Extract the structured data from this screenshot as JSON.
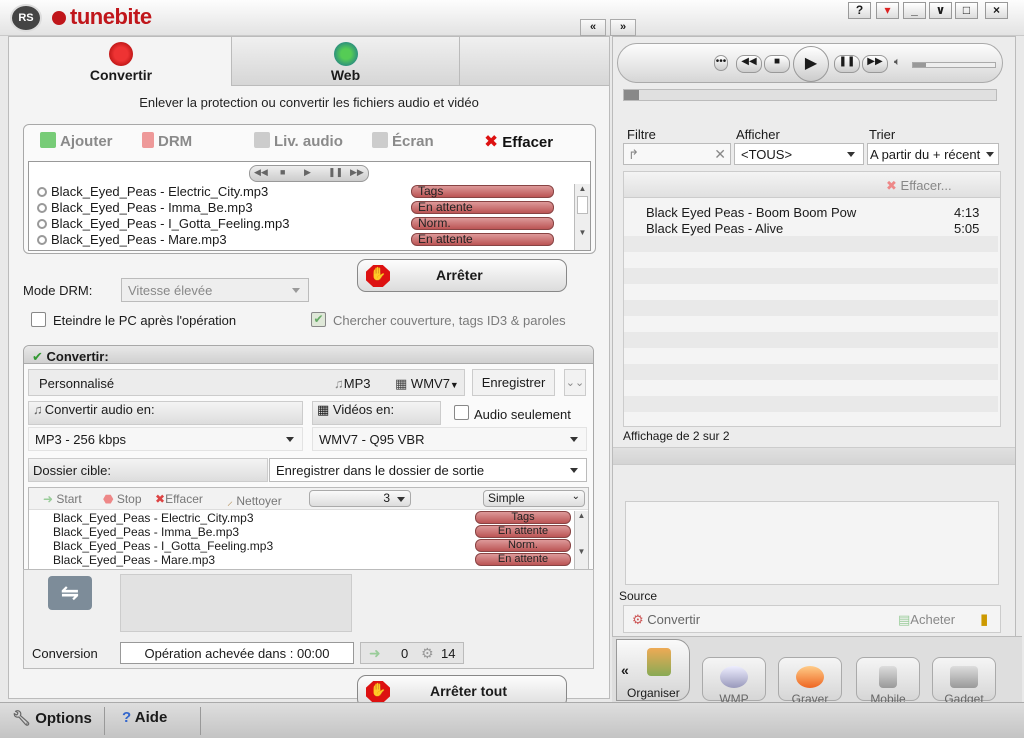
{
  "app": {
    "brand": "tunebite",
    "logo_text": "RS",
    "collapse_left": "«",
    "expand_right": "»",
    "window_buttons": [
      "?",
      "",
      "_",
      "∨",
      "□",
      "×"
    ]
  },
  "tabs": {
    "convert": "Convertir",
    "web": "Web"
  },
  "subtitle": "Enlever la protection ou convertir les fichiers audio et vidéo",
  "top_toolbar": {
    "add": "Ajouter",
    "drm": "DRM",
    "audio": "Liv. audio",
    "screen": "Écran",
    "clear": "Effacer"
  },
  "top_files": [
    {
      "name": "Black_Eyed_Peas - Electric_City.mp3",
      "status": "Tags"
    },
    {
      "name": "Black_Eyed_Peas - Imma_Be.mp3",
      "status": "En attente"
    },
    {
      "name": "Black_Eyed_Peas - I_Gotta_Feeling.mp3",
      "status": "Norm."
    },
    {
      "name": "Black_Eyed_Peas - Mare.mp3",
      "status": "En attente"
    }
  ],
  "stop_button": "Arrêter",
  "drm_mode": {
    "label": "Mode DRM:",
    "value": "Vitesse élevée"
  },
  "options": {
    "shutdown": "Eteindre le PC après l'opération",
    "cover": "Chercher couverture, tags ID3 & paroles"
  },
  "convert": {
    "header": "Convertir:",
    "profile": "Personnalisé",
    "fmt_audio": "MP3",
    "fmt_video": "WMV7",
    "save": "Enregistrer",
    "audio_label": "Convertir audio en:",
    "audio_value": "MP3 - 256 kbps",
    "video_label": "Vidéos en:",
    "video_value": "WMV7 - Q95 VBR",
    "audio_only": "Audio seulement",
    "folder_label": "Dossier cible:",
    "folder_value": "Enregistrer dans le dossier de sortie"
  },
  "queue_toolbar": {
    "start": "Start",
    "stop": "Stop",
    "clear": "Effacer",
    "clean": "Nettoyer",
    "count": "3",
    "mode": "Simple"
  },
  "queue_files": [
    {
      "name": "Black_Eyed_Peas - Electric_City.mp3",
      "status": "Tags"
    },
    {
      "name": "Black_Eyed_Peas - Imma_Be.mp3",
      "status": "En attente"
    },
    {
      "name": "Black_Eyed_Peas - I_Gotta_Feeling.mp3",
      "status": "Norm."
    },
    {
      "name": "Black_Eyed_Peas - Mare.mp3",
      "status": "En attente"
    }
  ],
  "conversion": {
    "label": "Conversion",
    "status": "Opération achevée dans : 00:00",
    "done": "0",
    "pending": "14"
  },
  "stop_all": "Arrêter tout",
  "right": {
    "filter_label": "Filtre",
    "show_label": "Afficher",
    "show_value": "<TOUS>",
    "sort_label": "Trier",
    "sort_value": "A partir du + récent",
    "clear": "Effacer...",
    "tracks": [
      {
        "title": "Black Eyed Peas - Boom Boom Pow",
        "time": "4:13"
      },
      {
        "title": "Black Eyed Peas - Alive",
        "time": "5:05"
      }
    ],
    "count_text": "Affichage de 2 sur 2",
    "source_label": "Source",
    "source_convert": "Convertir",
    "source_buy": "Acheter"
  },
  "bottom_tabs": {
    "organize": "Organiser",
    "wmp": "WMP",
    "burn": "Graver",
    "mobile": "Mobile",
    "gadget": "Gadget",
    "collapse": "«"
  },
  "footer": {
    "options": "Options",
    "help": "Aide"
  },
  "colors": {
    "brand": "#c0161b",
    "status_fill": "#c06060",
    "green_indicator": "#3bbf2a"
  }
}
